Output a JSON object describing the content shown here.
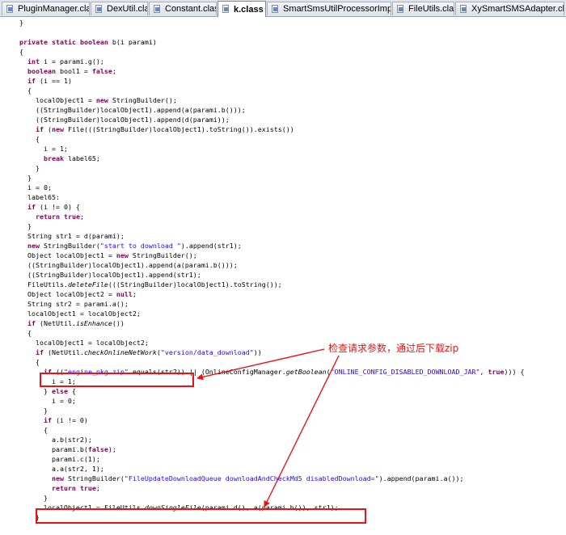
{
  "tabs": [
    {
      "label": "PluginManager.class",
      "active": false
    },
    {
      "label": "DexUtil.class",
      "active": false
    },
    {
      "label": "Constant.class",
      "active": false
    },
    {
      "label": "k.class",
      "active": true
    },
    {
      "label": "SmartSmsUtilProcessorImpl.class",
      "active": false
    },
    {
      "label": "FileUtils.class",
      "active": false
    },
    {
      "label": "XySmartSMSAdapter.class",
      "active": false
    }
  ],
  "close_symbol": "✕",
  "annotation": "检查请求参数，通过后下载zip",
  "colors": {
    "keyword": "#7f0055",
    "string": "#2a00ff",
    "highlight": "#ee1111"
  },
  "code": [
    "  }",
    "",
    "  private static boolean b(i parami)",
    "  {",
    "    int i = parami.g();",
    "    boolean bool1 = false;",
    "    if (i == 1)",
    "    {",
    "      localObject1 = new StringBuilder();",
    "      ((StringBuilder)localObject1).append(a(parami.b()));",
    "      ((StringBuilder)localObject1).append(d(parami));",
    "      if (new File(((StringBuilder)localObject1).toString()).exists())",
    "      {",
    "        i = 1;",
    "        break label65;",
    "      }",
    "    }",
    "    i = 0;",
    "    label65:",
    "    if (i != 0) {",
    "      return true;",
    "    }",
    "    String str1 = d(parami);",
    "    new StringBuilder(\"start to download \").append(str1);",
    "    Object localObject1 = new StringBuilder();",
    "    ((StringBuilder)localObject1).append(a(parami.b()));",
    "    ((StringBuilder)localObject1).append(str1);",
    "    FileUtils.deleteFile(((StringBuilder)localObject1).toString());",
    "    Object localObject2 = null;",
    "    String str2 = parami.a();",
    "    localObject1 = localObject2;",
    "    if (NetUtil.isEnhance())",
    "    {",
    "      localObject1 = localObject2;",
    "      if (NetUtil.checkOnlineNetWork(\"version/data_download\"))",
    "      {",
    "        if ((\"engine_pkg.zip\".equals(str2)) || (OnlineConfigManager.getBoolean(\"ONLINE_CONFIG_DISABLED_DOWNLOAD_JAR\", true))) {",
    "          i = 1;",
    "        } else {",
    "          i = 0;",
    "        }",
    "        if (i != 0)",
    "        {",
    "          a.b(str2);",
    "          parami.b(false);",
    "          parami.c(1);",
    "          a.a(str2, 1);",
    "          new StringBuilder(\"FileUpdateDownloadQueue downloadAndCheckMd5 disabledDownload=\").append(parami.a());",
    "          return true;",
    "        }",
    "        localObject1 = FileUtils.downSingleFile(parami.d(), a(parami.b()), str1);",
    "      }"
  ]
}
